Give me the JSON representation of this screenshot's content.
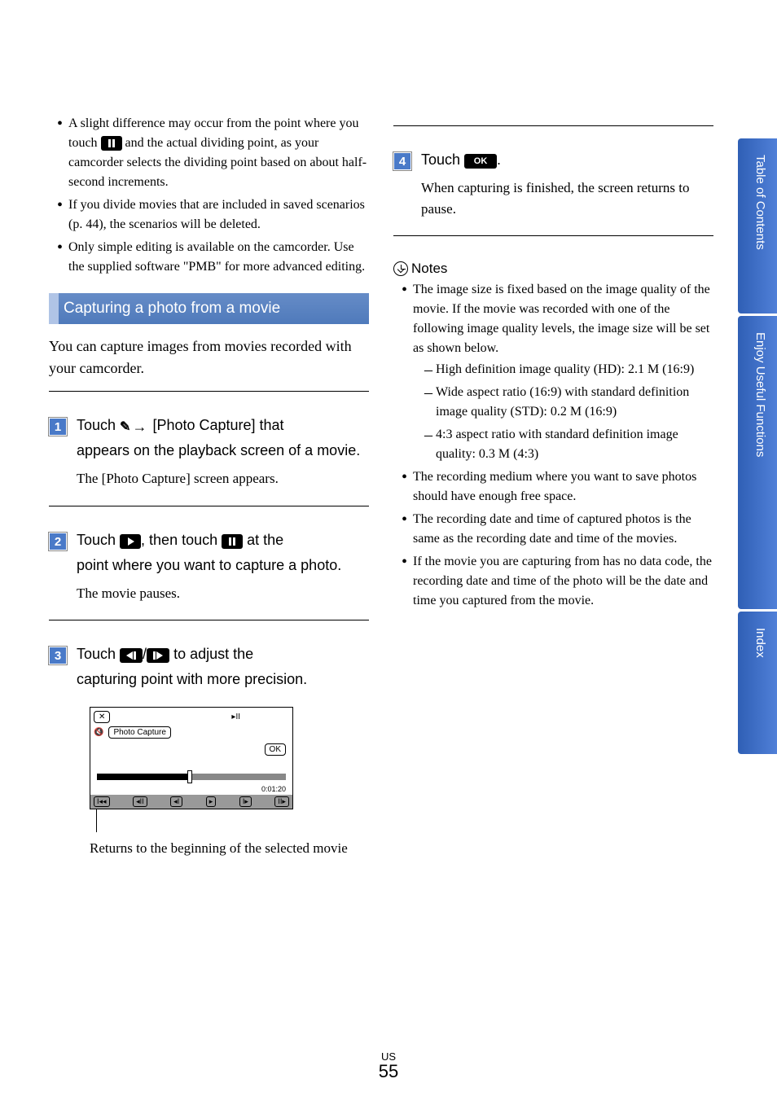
{
  "sideTabs": {
    "toc": "Table of Contents",
    "enjoy": "Enjoy Useful Functions",
    "index": "Index"
  },
  "leftCol": {
    "topBullets": [
      {
        "pre": "A slight difference may occur from the point where you touch ",
        "post": " and the actual dividing point, as your camcorder selects the dividing point based on about half-second increments."
      },
      "If you divide movies that are included in saved scenarios (p. 44), the scenarios will be deleted.",
      "Only simple editing is available on the camcorder. Use the supplied software \"PMB\" for more advanced editing."
    ],
    "sectionHeading": "Capturing a photo from a movie",
    "intro": "You can capture images from movies recorded with your camcorder.",
    "step1": {
      "num": "1",
      "t1": "Touch ",
      "t2": " [Photo Capture] that",
      "cont": "appears on the playback screen of a movie.",
      "detail": "The [Photo Capture] screen appears."
    },
    "step2": {
      "num": "2",
      "t1": "Touch ",
      "t2": ", then touch ",
      "t3": " at the",
      "cont": "point where you want to capture a photo.",
      "detail": "The movie pauses."
    },
    "step3": {
      "num": "3",
      "t1": "Touch ",
      "t2": "/",
      "t3": " to adjust the",
      "cont": "capturing point with more precision."
    },
    "screen": {
      "label": "Photo Capture",
      "ok": "OK",
      "time": "0:01:20"
    },
    "caption": "Returns to the beginning of the selected movie"
  },
  "rightCol": {
    "step4": {
      "num": "4",
      "t1": "Touch ",
      "t2": ".",
      "detail": "When capturing is finished, the screen returns to pause."
    },
    "notesLabel": "Notes",
    "notes": [
      {
        "text": "The image size is fixed based on the image quality of the movie. If the movie was recorded with one of the following image quality levels, the image size will be set as shown below.",
        "sub": [
          "High definition image quality (HD): 2.1 M (16:9)",
          "Wide aspect ratio (16:9) with standard definition image quality (STD): 0.2 M (16:9)",
          "4:3 aspect ratio with standard definition image quality: 0.3 M (4:3)"
        ]
      },
      "The recording medium where you want to save photos should have enough free space.",
      "The recording date and time of captured photos is the same as the recording date and time of the movies.",
      "If the movie you are capturing from has no data code, the recording date and time of the photo will be the date and time you captured from the movie."
    ]
  },
  "page": {
    "region": "US",
    "num": "55"
  }
}
